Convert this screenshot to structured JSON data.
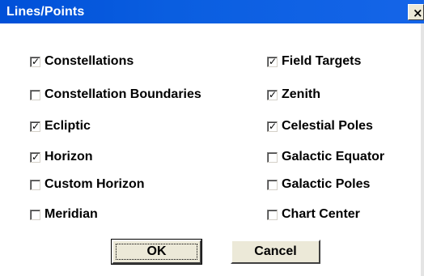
{
  "window": {
    "title": "Lines/Points",
    "close_glyph": "×"
  },
  "checkboxes": {
    "constellations": {
      "label": "Constellations",
      "checked": true
    },
    "constellation_boundaries": {
      "label": "Constellation Boundaries",
      "checked": false
    },
    "ecliptic": {
      "label": "Ecliptic",
      "checked": true
    },
    "horizon": {
      "label": "Horizon",
      "checked": true
    },
    "custom_horizon": {
      "label": "Custom Horizon",
      "checked": false
    },
    "meridian": {
      "label": "Meridian",
      "checked": false
    },
    "field_targets": {
      "label": "Field Targets",
      "checked": true
    },
    "zenith": {
      "label": "Zenith",
      "checked": true
    },
    "celestial_poles": {
      "label": "Celestial Poles",
      "checked": true
    },
    "galactic_equator": {
      "label": "Galactic Equator",
      "checked": false
    },
    "galactic_poles": {
      "label": "Galactic Poles",
      "checked": false
    },
    "chart_center": {
      "label": "Chart Center",
      "checked": false
    }
  },
  "check_glyph": "✓",
  "buttons": {
    "ok": "OK",
    "cancel": "Cancel"
  }
}
